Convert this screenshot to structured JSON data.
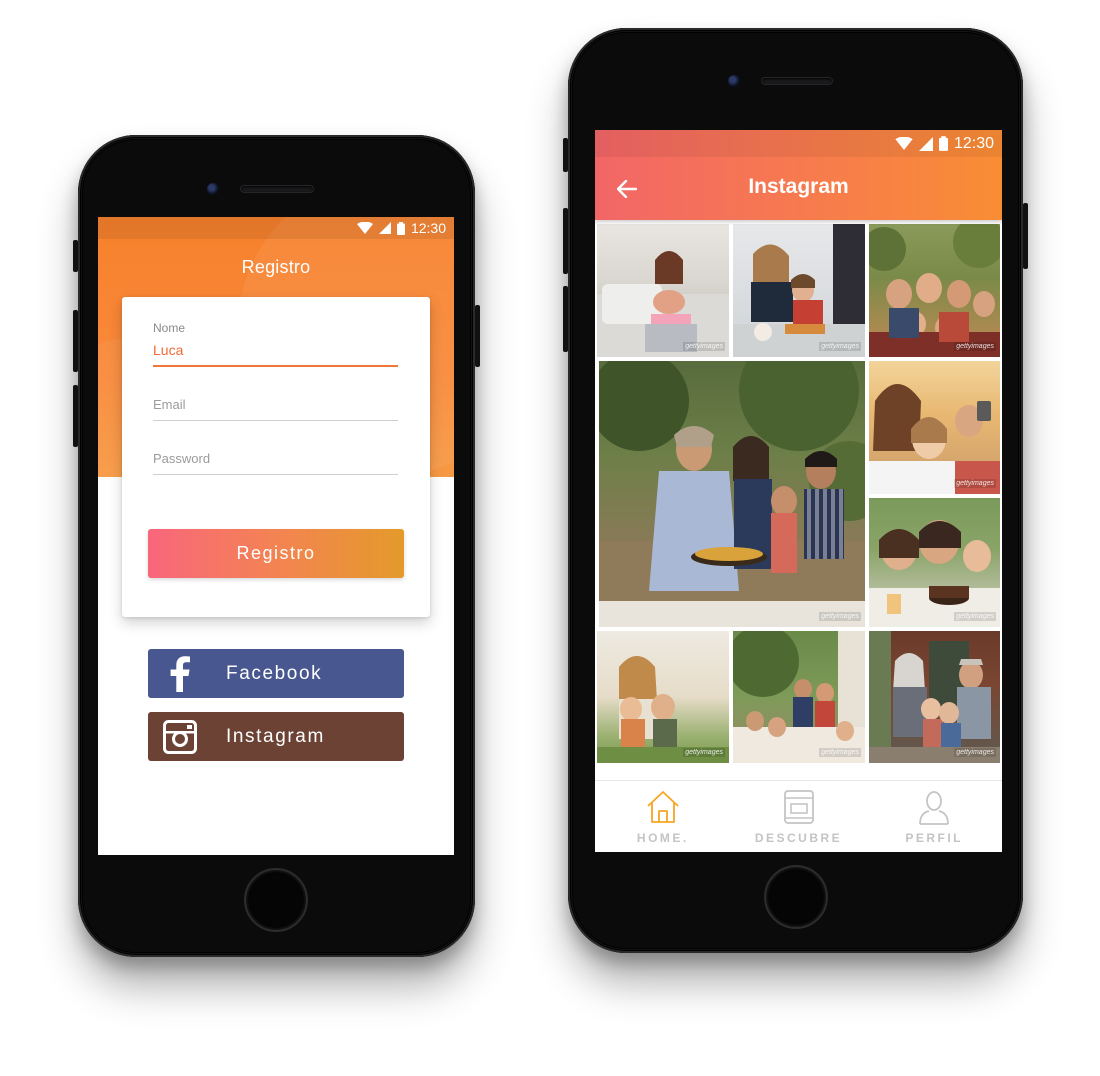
{
  "status": {
    "time": "12:30"
  },
  "register_screen": {
    "title": "Registro",
    "form": {
      "name_label": "Nome",
      "name_value": "Luca",
      "email_placeholder": "Email",
      "password_placeholder": "Password"
    },
    "submit_label": "Registro",
    "facebook_label": "Facebook",
    "instagram_label": "Instagram",
    "colors": {
      "facebook": "#48578f",
      "instagram": "#6b4234",
      "accent": "#f7812c"
    }
  },
  "instagram_screen": {
    "title": "Instagram",
    "watermark": "gettyimages",
    "photos": [
      "family-laptop-photo",
      "family-breakfast-photo",
      "family-group-selfie-photo",
      "family-garden-paella-photo",
      "family-selfie-photo",
      "family-birthday-cake-photo",
      "mother-children-field-photo",
      "family-outdoor-dinner-photo",
      "grandparents-porch-photo"
    ],
    "nav": [
      {
        "label": "HOME.",
        "icon": "home-icon"
      },
      {
        "label": "DESCUBRE",
        "icon": "book-icon"
      },
      {
        "label": "PERFIL",
        "icon": "user-icon"
      }
    ],
    "colors": {
      "nav_active": "#f5a623",
      "nav_inactive": "#c4c4c4"
    }
  }
}
